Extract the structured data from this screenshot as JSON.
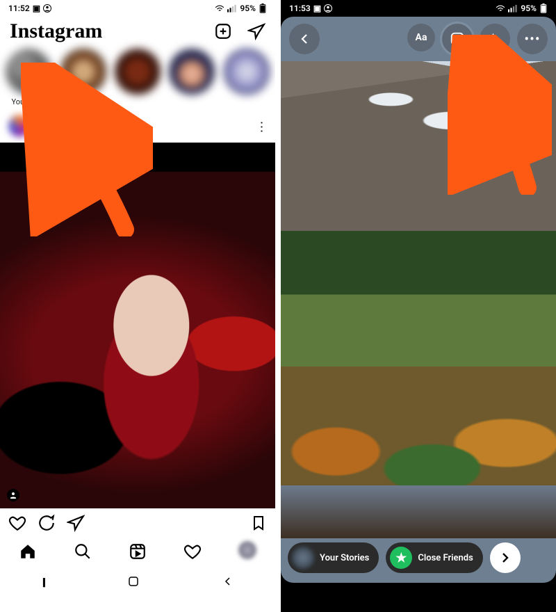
{
  "left": {
    "status": {
      "time": "11:52",
      "battery": "95%"
    },
    "brand": "Instagram",
    "stories": {
      "your_story_label": "Your story"
    },
    "nav": {
      "home": "home-icon",
      "search": "search-icon",
      "reels": "reels-icon",
      "activity": "heart-icon",
      "profile": "profile-avatar"
    }
  },
  "right": {
    "status": {
      "time": "11:53",
      "battery": "95%"
    },
    "toolbar": {
      "text_label": "Aa"
    },
    "share": {
      "your_stories_label": "Your Stories",
      "close_friends_label": "Close Friends"
    }
  }
}
